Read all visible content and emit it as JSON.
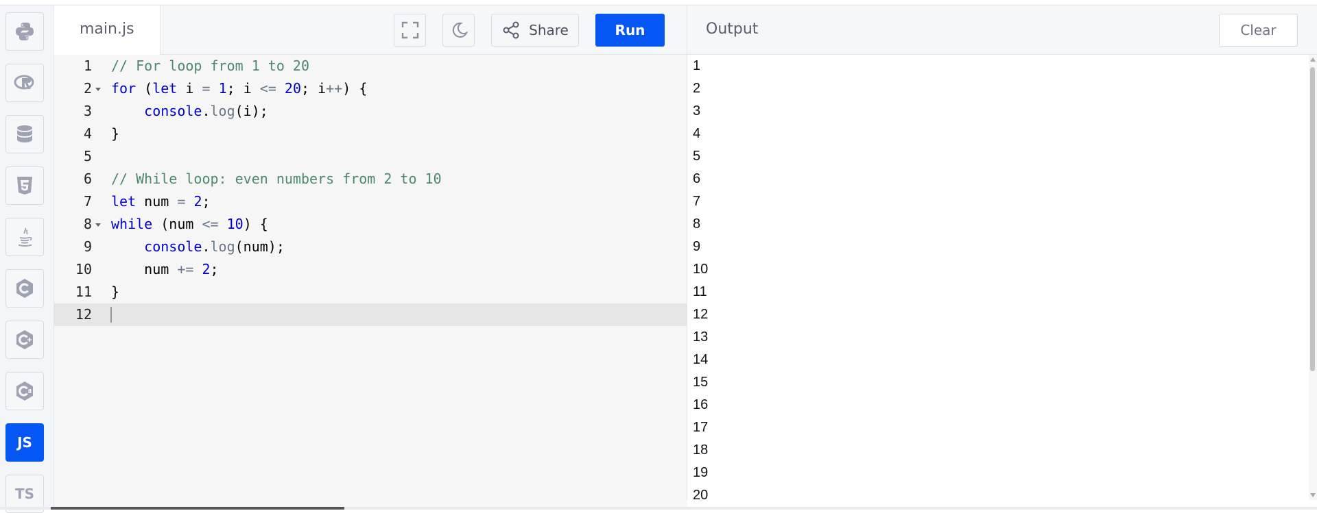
{
  "sidebar": {
    "items": [
      {
        "name": "python",
        "label": ""
      },
      {
        "name": "r",
        "label": ""
      },
      {
        "name": "sql",
        "label": ""
      },
      {
        "name": "html",
        "label": ""
      },
      {
        "name": "java",
        "label": ""
      },
      {
        "name": "c",
        "label": ""
      },
      {
        "name": "cpp",
        "label": ""
      },
      {
        "name": "csharp",
        "label": ""
      },
      {
        "name": "javascript",
        "label": "JS",
        "active": true
      },
      {
        "name": "typescript",
        "label": "TS"
      }
    ]
  },
  "editor": {
    "filename": "main.js",
    "share_label": "Share",
    "run_label": "Run",
    "lines": [
      {
        "n": "1"
      },
      {
        "n": "2"
      },
      {
        "n": "3"
      },
      {
        "n": "4"
      },
      {
        "n": "5"
      },
      {
        "n": "6"
      },
      {
        "n": "7"
      },
      {
        "n": "8"
      },
      {
        "n": "9"
      },
      {
        "n": "10"
      },
      {
        "n": "11"
      },
      {
        "n": "12"
      }
    ],
    "code": {
      "l1": "// For loop from 1 to 20",
      "l2_kw": "for",
      "l2_a": " (",
      "l2_let": "let",
      "l2_b": " i ",
      "l2_eq": "=",
      "l2_c": " ",
      "l2_one": "1",
      "l2_d": "; i ",
      "l2_le": "<=",
      "l2_e": " ",
      "l2_twenty": "20",
      "l2_f": "; i",
      "l2_pp": "++",
      "l2_g": ") {",
      "l3_a": "    ",
      "l3_obj": "console",
      "l3_dot": ".",
      "l3_fn": "log",
      "l3_b": "(i);",
      "l4": "}",
      "l6": "// While loop: even numbers from 2 to 10",
      "l7_kw": "let",
      "l7_a": " num ",
      "l7_eq": "=",
      "l7_b": " ",
      "l7_two": "2",
      "l7_c": ";",
      "l8_kw": "while",
      "l8_a": " (num ",
      "l8_le": "<=",
      "l8_b": " ",
      "l8_ten": "10",
      "l8_c": ") {",
      "l9_a": "    ",
      "l9_obj": "console",
      "l9_dot": ".",
      "l9_fn": "log",
      "l9_b": "(num);",
      "l10_a": "    num ",
      "l10_op": "+=",
      "l10_b": " ",
      "l10_two": "2",
      "l10_c": ";",
      "l11": "}"
    }
  },
  "output": {
    "title": "Output",
    "clear_label": "Clear",
    "lines": [
      "1",
      "2",
      "3",
      "4",
      "5",
      "6",
      "7",
      "8",
      "9",
      "10",
      "11",
      "12",
      "13",
      "14",
      "15",
      "16",
      "17",
      "18",
      "19",
      "20"
    ]
  },
  "colors": {
    "accent": "#0556f3",
    "keyword": "#0000cd",
    "comment": "#4c886b"
  }
}
